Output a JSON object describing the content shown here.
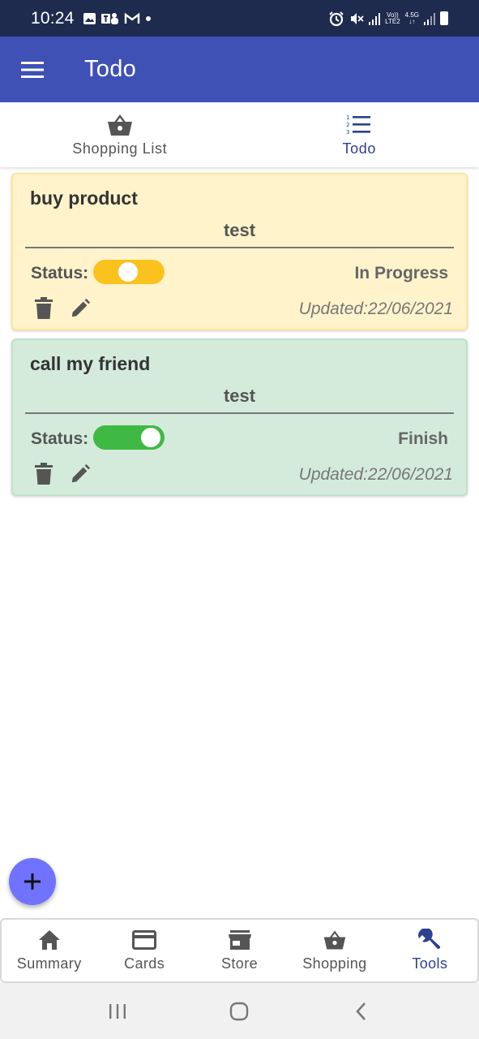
{
  "status_bar": {
    "time": "10:24",
    "network_top": "Vo))",
    "network_bottom": "LTE2",
    "network_type": "4.5G"
  },
  "app_bar": {
    "title": "Todo"
  },
  "top_tabs": [
    {
      "label": "Shopping List",
      "icon": "shopping-basket-icon",
      "active": false
    },
    {
      "label": "Todo",
      "icon": "numbered-list-icon",
      "active": true
    }
  ],
  "todos": [
    {
      "title": "buy product",
      "description": "test",
      "status_label": "Status:",
      "status": "In Progress",
      "updated": "Updated:22/06/2021",
      "color": "#fff3cc",
      "switch_color": "#fbc21d"
    },
    {
      "title": "call my friend",
      "description": "test",
      "status_label": "Status:",
      "status": "Finish",
      "updated": "Updated:22/06/2021",
      "color": "#d4ebdb",
      "switch_color": "#3fb944"
    }
  ],
  "fab": {
    "icon": "plus-icon",
    "color": "#6f73ff"
  },
  "bottom_nav": [
    {
      "label": "Summary",
      "icon": "home-icon",
      "active": false
    },
    {
      "label": "Cards",
      "icon": "credit-card-icon",
      "active": false
    },
    {
      "label": "Store",
      "icon": "store-icon",
      "active": false
    },
    {
      "label": "Shopping",
      "icon": "shopping-basket-icon",
      "active": false
    },
    {
      "label": "Tools",
      "icon": "wrench-icon",
      "active": true
    }
  ],
  "colors": {
    "app_bar": "#3f51b5",
    "status_bar": "#1f2a4f",
    "active": "#2d3f8f",
    "inactive": "#555555"
  }
}
